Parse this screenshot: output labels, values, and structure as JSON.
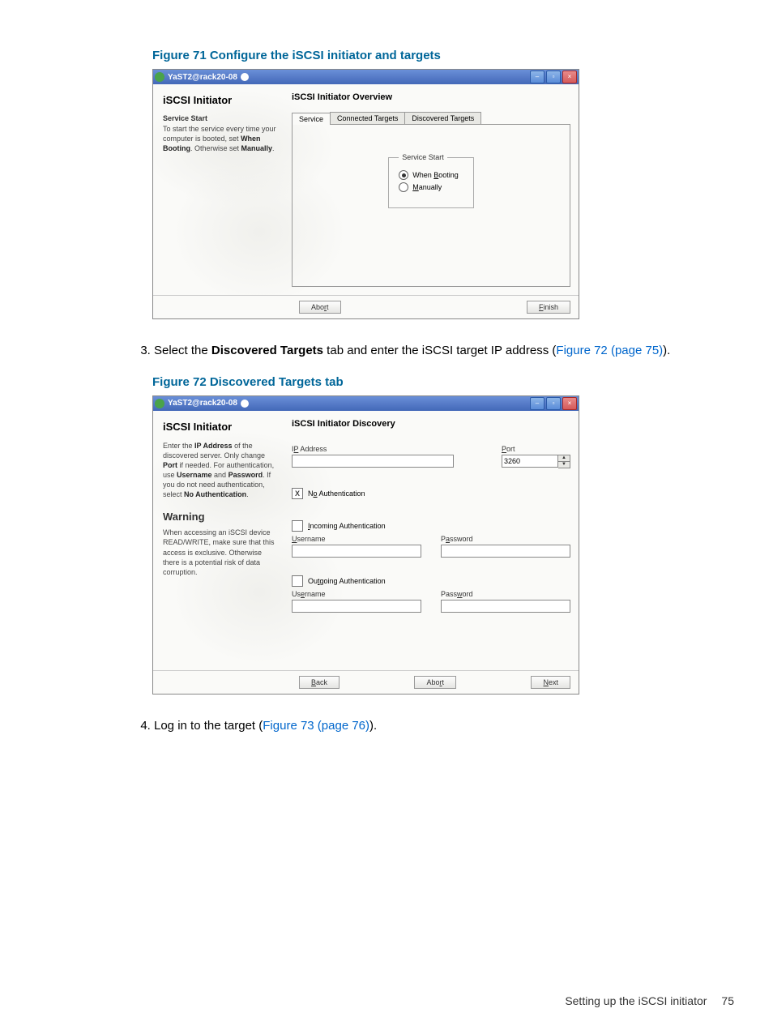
{
  "figure71": {
    "caption": "Figure 71 Configure the iSCSI initiator and targets",
    "window_title": "YaST2@rack20-08",
    "left_panel": {
      "title": "iSCSI Initiator",
      "sub_heading": "Service Start",
      "text_pre": "To start the service every time your computer is booted, set ",
      "bold1": "When Booting",
      "text_mid": ". Otherwise set ",
      "bold2": "Manually",
      "text_end": "."
    },
    "right_panel": {
      "title": "iSCSI Initiator Overview",
      "tabs": [
        "Service",
        "Connected Targets",
        "Discovered Targets"
      ],
      "fieldset_label": "Service Start",
      "radio1": "When Booting",
      "radio2": "Manually"
    },
    "buttons": {
      "abort": "Abort",
      "finish": "Finish"
    }
  },
  "step3": {
    "prefix": "Select the ",
    "bold": "Discovered Targets",
    "mid": " tab and enter the iSCSI target IP address (",
    "link": "Figure 72 (page 75)",
    "suffix": ")."
  },
  "figure72": {
    "caption": "Figure 72 Discovered Targets tab",
    "window_title": "YaST2@rack20-08",
    "left_panel": {
      "title": "iSCSI Initiator",
      "p1_pre": "Enter the ",
      "p1_b1": "IP Address",
      "p1_mid1": " of the discovered server. Only change ",
      "p1_b2": "Port",
      "p1_mid2": " if needed. For authentication, use ",
      "p1_b3": "Username",
      "p1_mid3": " and ",
      "p1_b4": "Password",
      "p1_mid4": ". If you do not need authentication, select ",
      "p1_b5": "No Authentication",
      "p1_end": ".",
      "warning": "Warning",
      "p2": "When accessing an iSCSI device READ/WRITE, make sure that this access is exclusive. Otherwise there is a potential risk of data corruption."
    },
    "right_panel": {
      "title": "iSCSI Initiator Discovery",
      "ip_label": "IP Address",
      "port_label": "Port",
      "port_value": "3260",
      "no_auth": "No Authentication",
      "incoming_auth": "Incoming Authentication",
      "outgoing_auth": "Outgoing Authentication",
      "username": "Username",
      "password": "Password"
    },
    "buttons": {
      "back": "Back",
      "abort": "Abort",
      "next": "Next"
    }
  },
  "step4": {
    "prefix": "Log in to the target (",
    "link": "Figure 73 (page 76)",
    "suffix": ")."
  },
  "footer": {
    "text": "Setting up the iSCSI initiator",
    "page": "75"
  }
}
